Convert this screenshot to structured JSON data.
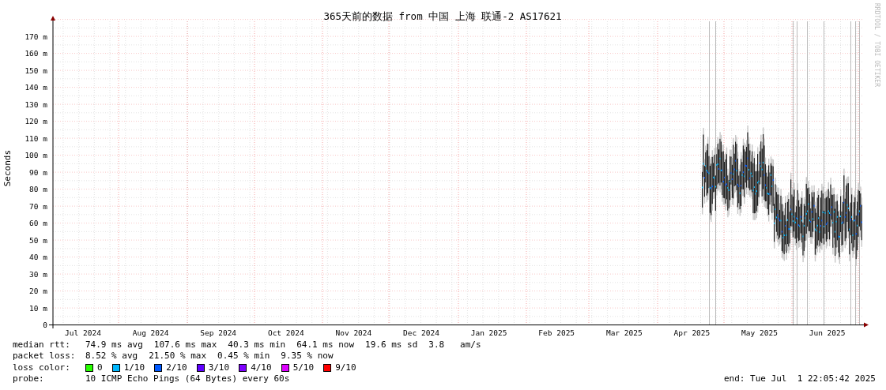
{
  "graph": {
    "title": "365天前的数据 from 中国 上海 联通-2 AS17621",
    "y_axis_label": "Seconds",
    "credit": "RRDTOOL / TOBI OETIKER",
    "y_ticks": [
      "170 m",
      "160 m",
      "150 m",
      "140 m",
      "130 m",
      "120 m",
      "110 m",
      "100 m",
      "90 m",
      "80 m",
      "70 m",
      "60 m",
      "50 m",
      "40 m",
      "30 m",
      "20 m",
      "10 m",
      "0"
    ],
    "x_labels": [
      "Jul 2024",
      "Aug 2024",
      "Sep 2024",
      "Oct 2024",
      "Nov 2024",
      "Dec 2024",
      "Jan 2025",
      "Feb 2025",
      "Mar 2025",
      "Apr 2025",
      "May 2025",
      "Jun 2025"
    ]
  },
  "legend": {
    "median_rtt": {
      "label": "median rtt:",
      "values": [
        "74.9 ms avg",
        "107.6 ms max",
        "40.3 ms min",
        "64.1 ms now",
        "19.6 ms sd",
        "3.8   am/s"
      ]
    },
    "packet_loss": {
      "label": "packet loss:",
      "values": [
        "8.52 % avg",
        "21.50 % max",
        "0.45 % min",
        "9.35 % now"
      ]
    },
    "loss_color": {
      "label": "loss color:",
      "items": [
        {
          "label": "0",
          "color": "#26ff00"
        },
        {
          "label": "1/10",
          "color": "#00b8ff"
        },
        {
          "label": "2/10",
          "color": "#0059ff"
        },
        {
          "label": "3/10",
          "color": "#5e00ff"
        },
        {
          "label": "4/10",
          "color": "#7e00ff"
        },
        {
          "label": "5/10",
          "color": "#dd00ff"
        },
        {
          "label": "9/10",
          "color": "#ff0000"
        }
      ]
    },
    "probe": {
      "label": "probe:",
      "value": "10 ICMP Echo Pings (64 Bytes) every 60s"
    },
    "end": "end: Tue Jul  1 22:05:42 2025"
  }
}
